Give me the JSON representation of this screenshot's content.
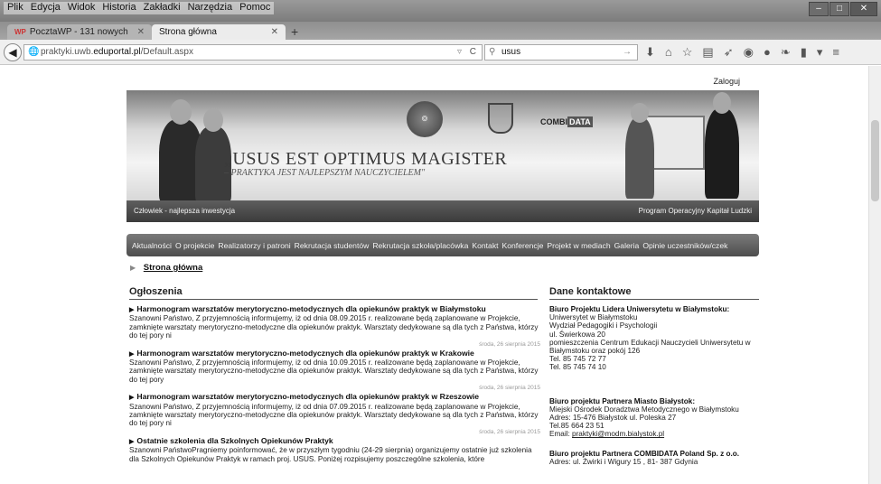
{
  "menu": [
    "Plik",
    "Edycja",
    "Widok",
    "Historia",
    "Zakładki",
    "Narzędzia",
    "Pomoc"
  ],
  "tabs": [
    {
      "icon": "WP",
      "label": "PocztaWP - 131 nowych"
    },
    {
      "label": "Strona główna"
    }
  ],
  "address": {
    "prefix": "praktyki.uwb.",
    "host": "eduportal.pl",
    "path": "/Default.aspx"
  },
  "search": {
    "value": "usus"
  },
  "page": {
    "login": "Zaloguj",
    "banner": {
      "motto": "„USUS EST OPTIMUS MAGISTER",
      "submotto": "– PRAKTYKA JEST NAJLEPSZYM NAUCZYCIELEM\"",
      "left_caption": "Człowiek - najlepsza inwestycja",
      "right_caption": "Program Operacyjny Kapitał Ludzki",
      "combi_a": "COMBI",
      "combi_b": "DATA"
    },
    "nav": [
      "Aktualności",
      "O projekcie",
      "Realizatorzy i patroni",
      "Rekrutacja studentów",
      "Rekrutacja szkoła/placówka",
      "Kontakt",
      "Konferencje",
      "Projekt w mediach",
      "Galeria",
      "Opinie uczestników/czek"
    ],
    "breadcrumb": "Strona główna",
    "announcements_title": "Ogłoszenia",
    "announcements": [
      {
        "title": "Harmonogram warsztatów merytoryczno-metodycznych dla opiekunów praktyk w Białymstoku",
        "body": "Szanowni Państwo,  Z przyjemnością informujemy, iż od dnia 08.09.2015 r. realizowane będą zaplanowane w Projekcie, zamknięte warsztaty merytoryczno-metodyczne dla opiekunów praktyk. Warsztaty dedykowane są dla tych z Państwa, którzy do tej pory ni",
        "date": "środa, 26 sierpnia 2015"
      },
      {
        "title": "Harmonogram warsztatów merytoryczno-metodycznych dla opiekunów praktyk w Krakowie",
        "body": "Szanowni Państwo,  Z przyjemnością informujemy, iż od dnia 10.09.2015 r. realizowane będą zaplanowane w Projekcie, zamknięte warsztaty merytoryczno-metodyczne dla opiekunów praktyk. Warsztaty dedykowane są dla tych z Państwa, którzy do tej pory",
        "date": "środa, 26 sierpnia 2015"
      },
      {
        "title": "Harmonogram warsztatów merytoryczno-metodycznych dla opiekunów praktyk w Rzeszowie",
        "body": "Szanowni Państwo,  Z przyjemnością informujemy, iż od dnia 07.09.2015 r. realizowane będą zaplanowane w Projekcie, zamknięte warsztaty merytoryczno-metodyczne dla opiekunów praktyk. Warsztaty dedykowane są dla tych z Państwa, którzy do tej pory ni",
        "date": "środa, 26 sierpnia 2015"
      },
      {
        "title": "Ostatnie szkolenia dla Szkolnych Opiekunów Praktyk",
        "body": "Szanowni PaństwoPragniemy poinformować, że w przyszłym tygodniu (24-29 sierpnia) organizujemy ostatnie już szkolenia dla Szkolnych Opiekunów Praktyk w ramach proj. USUS. Poniżej rozpisujemy poszczególne szkolenia, które",
        "date": ""
      }
    ],
    "contact_title": "Dane kontaktowe",
    "contacts": [
      {
        "heading": "Biuro Projektu Lidera Uniwersytetu w Białymstoku:",
        "lines": [
          "Uniwersytet w Białymstoku",
          "Wydział Pedagogiki i Psychologii",
          "ul. Świerkowa 20",
          "pomieszczenia Centrum Edukacji Nauczycieli Uniwersytetu w Białymstoku oraz pokój 126",
          "Tel. 85 745 72 77",
          "Tel. 85 745 74 10"
        ]
      },
      {
        "heading": "Biuro projektu Partnera Miasto Białystok:",
        "lines": [
          "Miejski Ośrodek Doradztwa Metodycznego w Białymstoku",
          "Adres: 15-476 Białystok ul. Poleska 27",
          "Tel.85 664 23 51"
        ],
        "email_label": "Email: ",
        "email": "praktyki@modm.bialystok.pl"
      },
      {
        "heading": "Biuro projektu Partnera COMBIDATA Poland Sp. z o.o.",
        "lines": [
          "Adres: ul. Żwirki i Wigury 15 , 81- 387 Gdynia"
        ]
      }
    ]
  }
}
